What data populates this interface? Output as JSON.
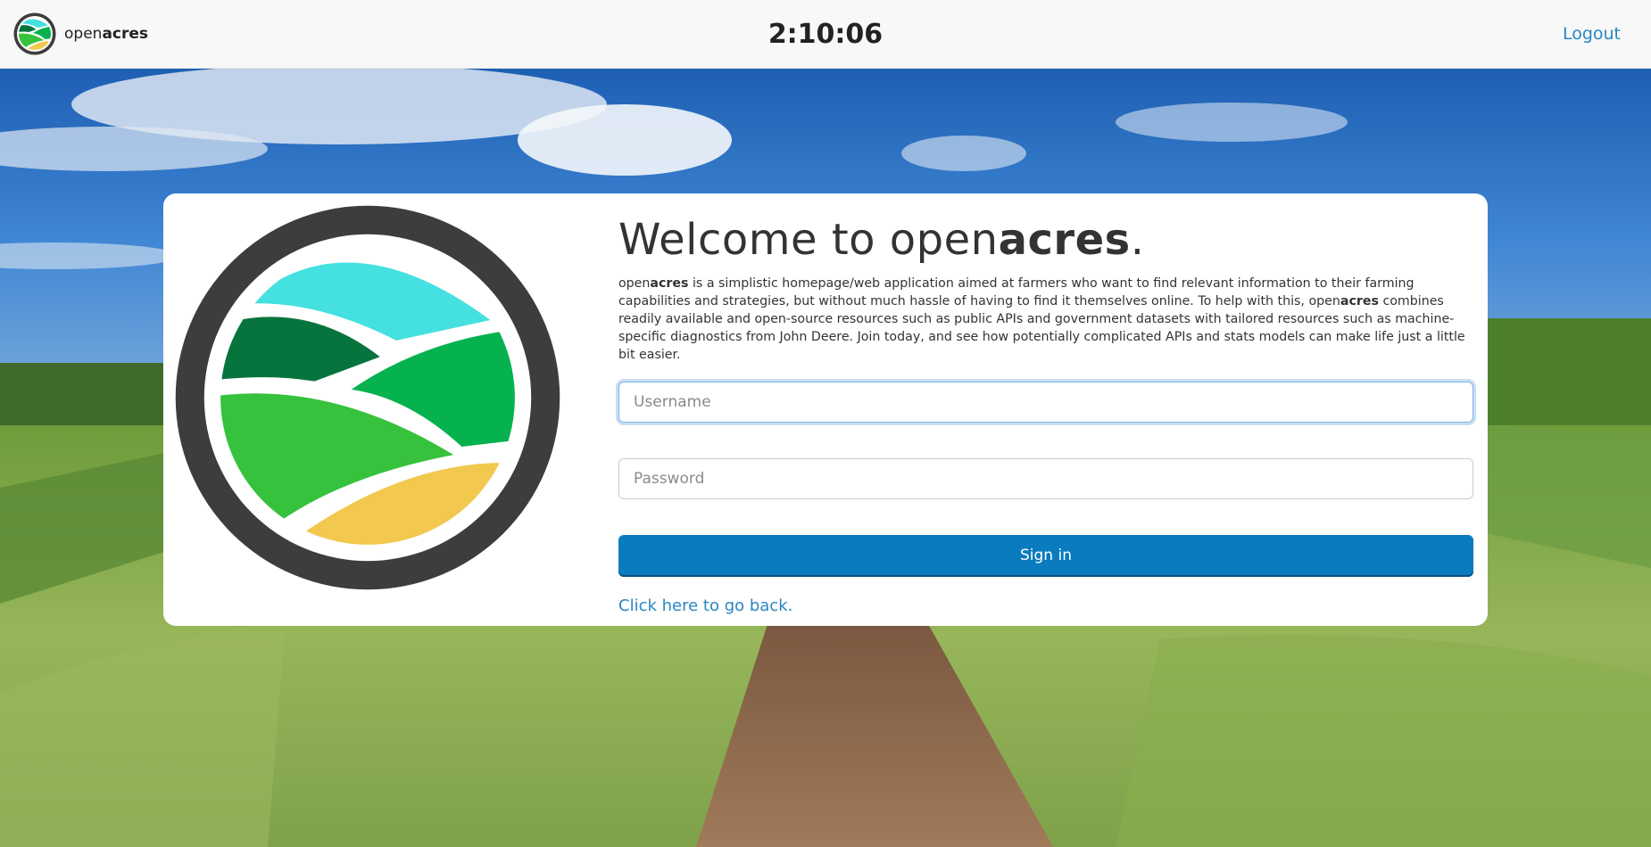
{
  "nav": {
    "brand_prefix": "open",
    "brand_bold": "acres",
    "clock": "2:10:06",
    "logout_label": "Logout"
  },
  "login": {
    "title_prefix": "Welcome to open",
    "title_bold": "acres",
    "title_suffix": ".",
    "desc_brand_prefix": "open",
    "desc_brand_bold": "acres",
    "desc_part1": " is a simplistic homepage/web application aimed at farmers who want to find relevant information to their farming capabilities and strategies, but without much hassle of having to find it themselves online. To help with this, ",
    "desc_brand2_prefix": "open",
    "desc_brand2_bold": "acres",
    "desc_part2": " combines readily available and open-source resources such as public APIs and government datasets with tailored resources such as machine-specific diagnostics from John Deere. Join today, and see how potentially complicated APIs and stats models can make life just a little bit easier.",
    "username_placeholder": "Username",
    "username_value": "",
    "password_placeholder": "Password",
    "password_value": "",
    "signin_label": "Sign in",
    "back_link": "Click here to go back."
  },
  "colors": {
    "accent": "#0a7bbf",
    "link": "#2a86c3",
    "logo_ring": "#3d3d3d",
    "logo_cyan": "#45e0e0",
    "logo_dark_green": "#07743e",
    "logo_green": "#06b24d",
    "logo_light_green": "#36c23c",
    "logo_yellow": "#f2c84f"
  },
  "icons": {
    "brand": "openacres-logo-icon"
  }
}
